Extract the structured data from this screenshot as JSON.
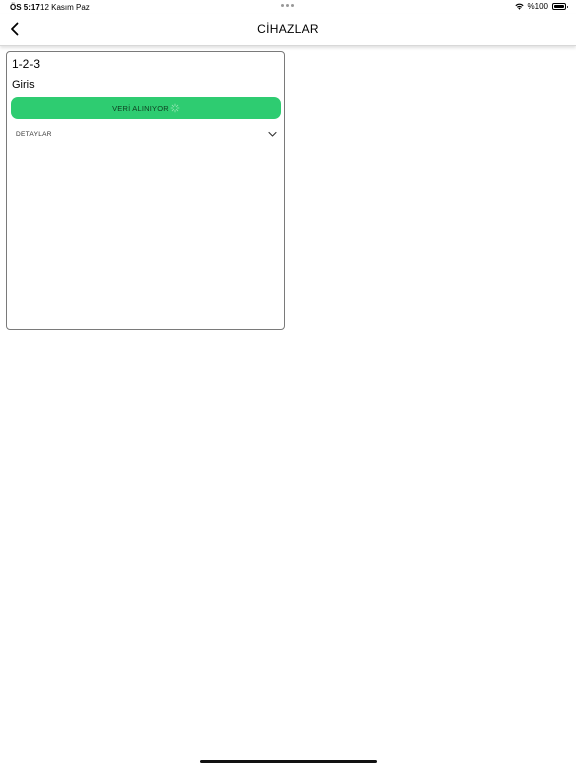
{
  "status_bar": {
    "time": "ÖS 5:17",
    "date": "12 Kasım Paz",
    "battery": "%100",
    "wifi_icon": "wifi-icon",
    "battery_icon": "battery-icon"
  },
  "navbar": {
    "title": "CİHAZLAR",
    "back_icon": "chevron-left-icon"
  },
  "device_card": {
    "id": "1-2-3",
    "status": "Giris",
    "data_button_label": "VERİ ALINIYOR",
    "spinner_icon": "spinner-icon",
    "details_label": "DETAYLAR",
    "details_icon": "chevron-down-icon"
  },
  "colors": {
    "button_green": "#2ecc71",
    "card_border": "#7a7a7a"
  }
}
